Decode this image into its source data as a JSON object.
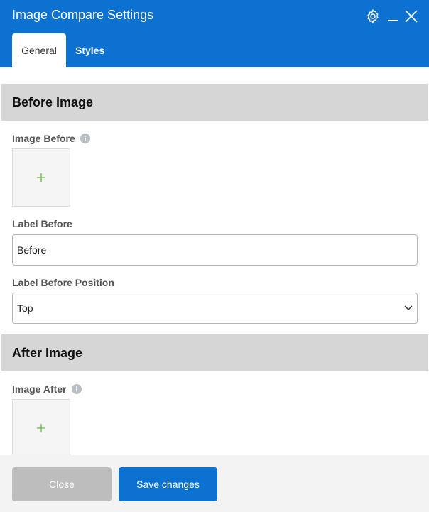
{
  "window": {
    "title": "Image Compare Settings"
  },
  "header_icons": [
    "gear-icon",
    "minimize-icon",
    "close-icon"
  ],
  "tabs": [
    {
      "label": "General",
      "active": true
    },
    {
      "label": "Styles",
      "active": false
    }
  ],
  "sections": {
    "before": {
      "heading": "Before Image",
      "image_label": "Image Before",
      "text_label": "Label Before",
      "text_value": "Before",
      "position_label": "Label Before Position",
      "position_value": "Top"
    },
    "after": {
      "heading": "After Image",
      "image_label": "Image After"
    }
  },
  "footer": {
    "close_label": "Close",
    "save_label": "Save changes"
  },
  "colors": {
    "accent": "#0b72d2",
    "plus": "#6cc04a",
    "section_bg": "#d6d6d6"
  }
}
